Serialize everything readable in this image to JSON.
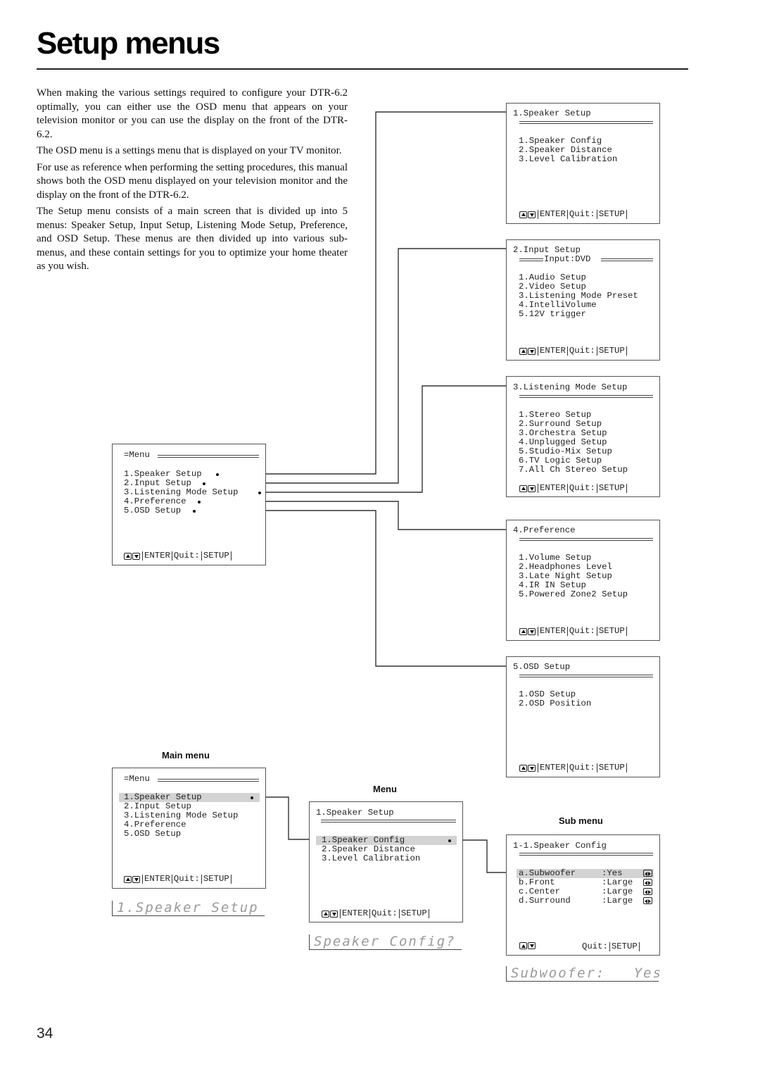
{
  "page": {
    "title": "Setup menus",
    "page_number": "34",
    "intro_paragraphs": [
      "When making the various settings required to configure your DTR-6.2 optimally, you can either use the OSD menu that appears on your television monitor or you can use the display on the front of the DTR-6.2.",
      "The OSD menu is a settings menu that is displayed on your TV monitor.",
      "For use as reference when performing the setting procedures, this manual shows both the OSD menu displayed on your television monitor and the display on the front of the DTR-6.2.",
      "The Setup menu consists of a main screen that is divided up into 5 menus: Speaker Setup, Input Setup, Listening Mode Setup, Preference, and OSD Setup. These menus are then divided up into various sub-menus, and these contain settings for you to optimize your home theater as you wish."
    ]
  },
  "footer": {
    "enter": "ENTER",
    "quit": "Quit:",
    "setup": "SETUP"
  },
  "overview_main_menu": {
    "header": "=Menu",
    "items": [
      "1.Speaker Setup",
      "2.Input Setup",
      "3.Listening Mode Setup",
      "4.Preference",
      "5.OSD Setup"
    ]
  },
  "submenus": [
    {
      "title": "1.Speaker Setup",
      "subtitle": "",
      "items": [
        "1.Speaker Config",
        "2.Speaker Distance",
        "3.Level Calibration"
      ]
    },
    {
      "title": "2.Input Setup",
      "subtitle": "Input:DVD",
      "items": [
        "1.Audio Setup",
        "2.Video Setup",
        "3.Listening Mode Preset",
        "4.IntelliVolume",
        "5.12V trigger"
      ]
    },
    {
      "title": "3.Listening Mode Setup",
      "subtitle": "",
      "items": [
        "1.Stereo Setup",
        "2.Surround Setup",
        "3.Orchestra Setup",
        "4.Unplugged Setup",
        "5.Studio-Mix Setup",
        "6.TV Logic Setup",
        "7.All Ch Stereo Setup"
      ]
    },
    {
      "title": "4.Preference",
      "subtitle": "",
      "items": [
        "1.Volume Setup",
        "2.Headphones Level",
        "3.Late Night Setup",
        "4.IR IN Setup",
        "5.Powered Zone2 Setup"
      ]
    },
    {
      "title": "5.OSD Setup",
      "subtitle": "",
      "items": [
        "1.OSD Setup",
        "2.OSD Position"
      ]
    }
  ],
  "example": {
    "main_menu": {
      "caption": "Main menu",
      "header": "=Menu",
      "items": [
        "1.Speaker Setup",
        "2.Input Setup",
        "3.Listening Mode Setup",
        "4.Preference",
        "5.OSD Setup"
      ],
      "selected_index": 0,
      "front_display": "1.Speaker Setup"
    },
    "menu": {
      "caption": "Menu",
      "title": "1.Speaker Setup",
      "items": [
        "1.Speaker Config",
        "2.Speaker Distance",
        "3.Level Calibration"
      ],
      "selected_index": 0,
      "front_display": "Speaker Config?"
    },
    "sub_menu": {
      "caption": "Sub menu",
      "title": "1-1.Speaker Config",
      "rows": [
        {
          "label": "a.Subwoofer",
          "value": ":Yes"
        },
        {
          "label": "b.Front",
          "value": ":Large"
        },
        {
          "label": "c.Center",
          "value": ":Large"
        },
        {
          "label": "d.Surround",
          "value": ":Large"
        }
      ],
      "selected_index": 0,
      "front_display": "Subwoofer:   Yes"
    }
  }
}
